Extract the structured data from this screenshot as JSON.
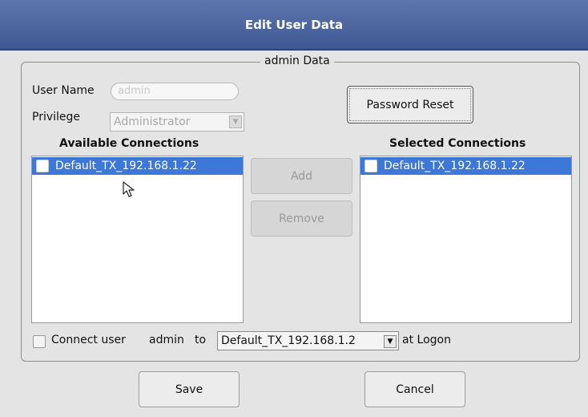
{
  "window": {
    "title": "Edit User Data"
  },
  "group": {
    "legend": "admin Data"
  },
  "user_name": {
    "label": "User Name",
    "value": "admin"
  },
  "privilege": {
    "label": "Privilege",
    "value": "Administrator"
  },
  "password_reset": {
    "label": "Password Reset"
  },
  "available": {
    "heading": "Available Connections",
    "items": [
      "Default_TX_192.168.1.22"
    ]
  },
  "selected": {
    "heading": "Selected Connections",
    "items": [
      "Default_TX_192.168.1.22"
    ]
  },
  "add_button": {
    "label": "Add"
  },
  "remove_button": {
    "label": "Remove"
  },
  "logon": {
    "checkbox_label": "Connect user",
    "user": "admin",
    "to": "to",
    "connection": "Default_TX_192.168.1.2",
    "suffix": "at Logon"
  },
  "footer": {
    "save": "Save",
    "cancel": "Cancel"
  },
  "colors": {
    "titlebar": "#4a63a0",
    "selection": "#3d78d8",
    "background": "#e4e4e4"
  }
}
